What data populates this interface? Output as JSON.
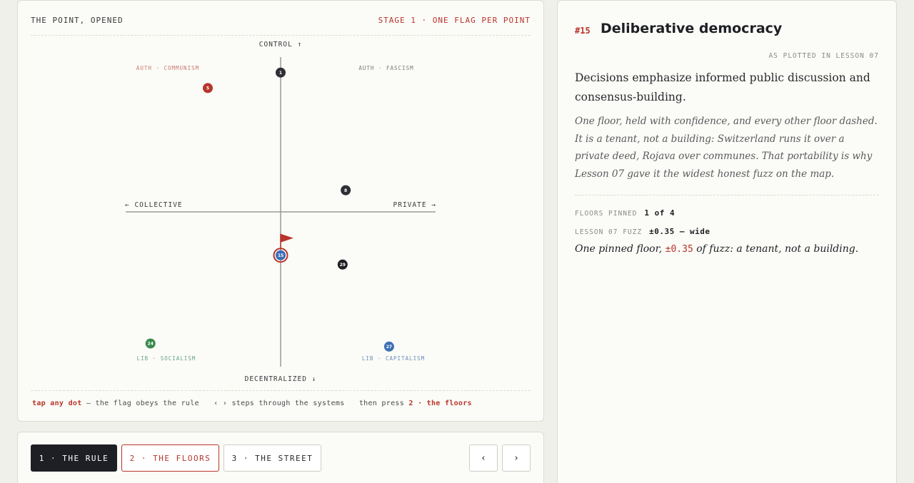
{
  "map": {
    "header_left": "THE POINT, OPENED",
    "header_right": "STAGE 1 · ONE FLAG PER POINT",
    "axes": {
      "top": "CONTROL ↑",
      "bottom": "DECENTRALIZED ↓",
      "left": "← COLLECTIVE",
      "right": "PRIVATE →"
    },
    "quadrants": {
      "top_left": "AUTH · COMMUNISM",
      "top_right": "AUTH · FASCISM",
      "bottom_left": "LIB · SOCIALISM",
      "bottom_right": "LIB · CAPITALISM"
    },
    "footer": {
      "tap": "tap any dot",
      "rule": "— the flag obeys the rule",
      "steps": "‹ › steps through the systems",
      "then": "then press",
      "floors": "2 · the floors"
    }
  },
  "points": [
    {
      "id": "1",
      "x": 0.0,
      "y": 0.9,
      "color": "#2e2f35",
      "selected": false
    },
    {
      "id": "5",
      "x": -0.47,
      "y": 0.8,
      "color": "#b8352b",
      "selected": false
    },
    {
      "id": "8",
      "x": 0.42,
      "y": 0.14,
      "color": "#2e2f35",
      "selected": false
    },
    {
      "id": "15",
      "x": 0.0,
      "y": -0.28,
      "color": "#3d6fb5",
      "selected": true
    },
    {
      "id": "29",
      "x": 0.4,
      "y": -0.34,
      "color": "#1e1f24",
      "selected": false
    },
    {
      "id": "24",
      "x": -0.84,
      "y": -0.85,
      "color": "#3a8a4e",
      "selected": false
    },
    {
      "id": "27",
      "x": 0.7,
      "y": -0.87,
      "color": "#3d6fb5",
      "selected": false
    }
  ],
  "colors": {
    "accent": "#b8352b",
    "dark": "#1e1f24",
    "auth_label": "#c97a72",
    "lib_label": "#6aa58a",
    "fascism_label": "#7a7a7a",
    "capitalism_label": "#6a8fc0"
  },
  "tabs": {
    "rule": "1 · THE RULE",
    "floors": "2 · THE FLOORS",
    "street": "3 · THE STREET",
    "prev": "‹",
    "next": "›"
  },
  "detail": {
    "number": "#15",
    "title": "Deliberative democracy",
    "plotted": "AS PLOTTED IN LESSON 07",
    "summary": "Decisions emphasize informed public discussion and consensus-building.",
    "body": "One floor, held with confidence, and every other floor dashed. It is a tenant, not a building: Switzerland runs it over a private deed, Rojava over communes. That portability is why Lesson 07 gave it the widest honest fuzz on the map.",
    "stats": {
      "floors_label": "FLOORS PINNED",
      "floors_value": "1 of 4",
      "fuzz_label": "LESSON 07 FUZZ",
      "fuzz_value": "±0.35 — wide"
    },
    "conclusion": {
      "pre": "One pinned floor,",
      "value": "±0.35",
      "post": "of fuzz: a tenant, not a building."
    }
  }
}
